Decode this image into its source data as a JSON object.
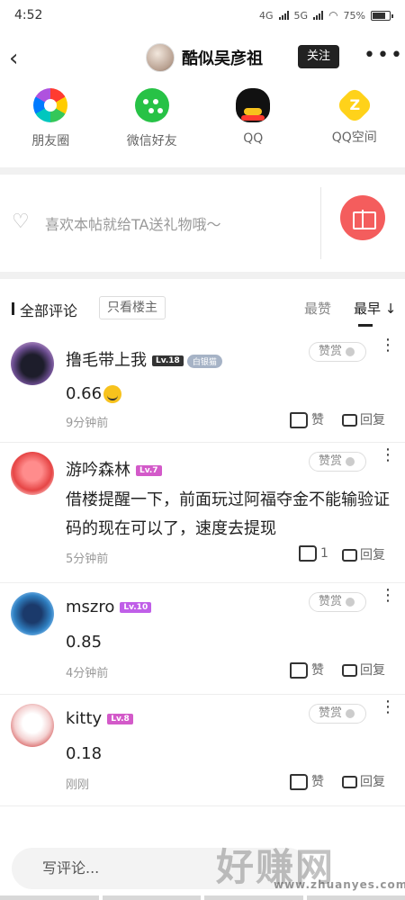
{
  "status": {
    "time": "4:52",
    "net1": "4G",
    "net2": "5G",
    "battery": "75%",
    "battery_level": 0.75
  },
  "header": {
    "author": "酷似吴彦祖",
    "follow": "关注"
  },
  "share": [
    {
      "label": "朋友圈",
      "icon": "moments-icon"
    },
    {
      "label": "微信好友",
      "icon": "wechat-icon"
    },
    {
      "label": "QQ",
      "icon": "qq-icon"
    },
    {
      "label": "QQ空间",
      "icon": "qzone-icon"
    }
  ],
  "gift": {
    "text": "喜欢本帖就给TA送礼物哦～"
  },
  "comments_header": {
    "title": "全部评论",
    "filter": "只看楼主",
    "sort_hot": "最赞",
    "sort_early": "最早 ↓"
  },
  "comments": [
    {
      "name": "撸毛带上我",
      "level": "Lv.18",
      "badge": "白银猫",
      "text": "0.66",
      "time": "9分钟前",
      "likes": "赞",
      "reply": "回复",
      "tip": "赞赏"
    },
    {
      "name": "游吟森林",
      "level": "Lv.7",
      "badge": "",
      "text": "借楼提醒一下，前面玩过阿福夺金不能输验证码的现在可以了，速度去提现",
      "time": "5分钟前",
      "likes": "1",
      "reply": "回复",
      "tip": "赞赏"
    },
    {
      "name": "mszro",
      "level": "Lv.10",
      "badge": "",
      "text": "0.85",
      "time": "4分钟前",
      "likes": "赞",
      "reply": "回复",
      "tip": "赞赏"
    },
    {
      "name": "kitty",
      "level": "Lv.8",
      "badge": "",
      "text": "0.18",
      "time": "刚刚",
      "likes": "赞",
      "reply": "回复",
      "tip": "赞赏"
    }
  ],
  "bottom": {
    "placeholder": "写评论...",
    "watermark": "好赚网",
    "watermark_url": "www.zhuanyes.com"
  },
  "colors": {
    "accent": "#f45d5d",
    "level_dark": "#333333",
    "level_pink": "#d35ac9",
    "level_purple": "#c05fe8"
  }
}
